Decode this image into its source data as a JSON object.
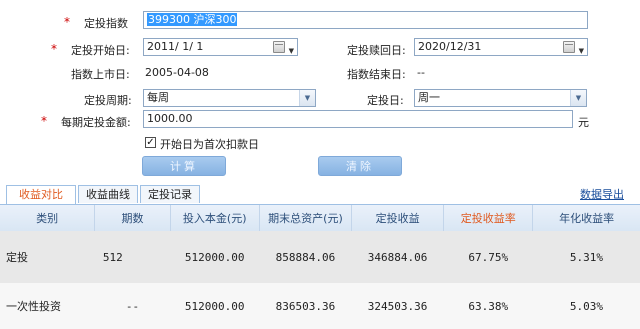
{
  "form": {
    "index_label": "定投指数",
    "index_value": "399300 沪深300",
    "start_label": "定投开始日:",
    "start_value": "2011/ 1/ 1",
    "redeem_label": "定投赎回日:",
    "redeem_value": "2020/12/31",
    "listing_label": "指数上市日:",
    "listing_value": "2005-04-08",
    "end_label": "指数结束日:",
    "end_value": "--",
    "period_label": "定投周期:",
    "period_value": "每周",
    "day_label": "定投日:",
    "day_value": "周一",
    "amount_label": "每期定投金额:",
    "amount_value": "1000.00",
    "amount_unit": "元",
    "checkbox_label": "开始日为首次扣款日",
    "checkbox_checked": true,
    "calc_label": "计算",
    "clear_label": "清除",
    "required_mark": "*"
  },
  "tabs": [
    "收益对比",
    "收益曲线",
    "定投记录"
  ],
  "export_label": "数据导出",
  "table": {
    "headers": [
      "类别",
      "期数",
      "投入本金(元)",
      "期末总资产(元)",
      "定投收益",
      "定投收益率",
      "年化收益率"
    ],
    "rows": [
      [
        "定投",
        "512",
        "512000.00",
        "858884.06",
        "346884.06",
        "67.75%",
        "5.31%"
      ],
      [
        "一次性投资",
        "--",
        "512000.00",
        "836503.36",
        "324503.36",
        "63.38%",
        "5.03%"
      ]
    ]
  },
  "colors": {
    "accent": "#e05a20",
    "header_text": "#2d4f7a",
    "selection": "#3399ff"
  }
}
